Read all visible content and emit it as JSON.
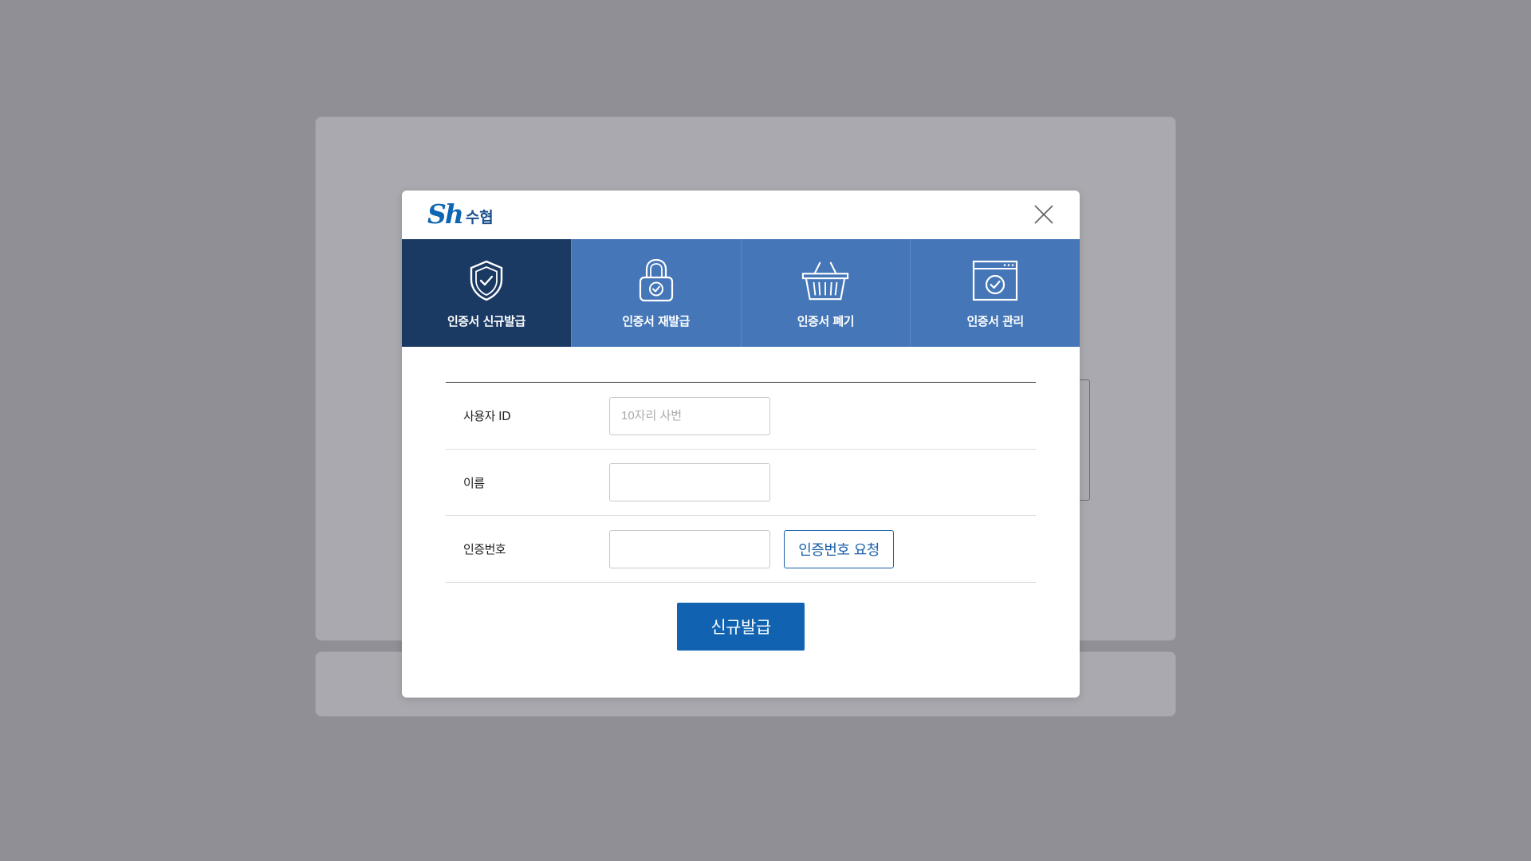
{
  "modal": {
    "logo": {
      "mark": "Sh",
      "text": "수협"
    },
    "tabs": [
      {
        "label": "인증서 신규발급",
        "icon": "shield-check-icon",
        "active": true
      },
      {
        "label": "인증서 재발급",
        "icon": "lock-check-icon",
        "active": false
      },
      {
        "label": "인증서 폐기",
        "icon": "basket-icon",
        "active": false
      },
      {
        "label": "인증서 관리",
        "icon": "window-check-icon",
        "active": false
      }
    ],
    "form": {
      "user_id": {
        "label": "사용자 ID",
        "placeholder": "10자리 사번",
        "value": ""
      },
      "name": {
        "label": "이름",
        "placeholder": "",
        "value": ""
      },
      "auth_code": {
        "label": "인증번호",
        "placeholder": "",
        "value": "",
        "request_button": "인증번호 요청"
      }
    },
    "submit_label": "신규발급"
  },
  "colors": {
    "tab_active": "#1a3a64",
    "tab_inactive": "#4476b8",
    "primary_button": "#1163b1",
    "brand": "#0d66b3"
  }
}
